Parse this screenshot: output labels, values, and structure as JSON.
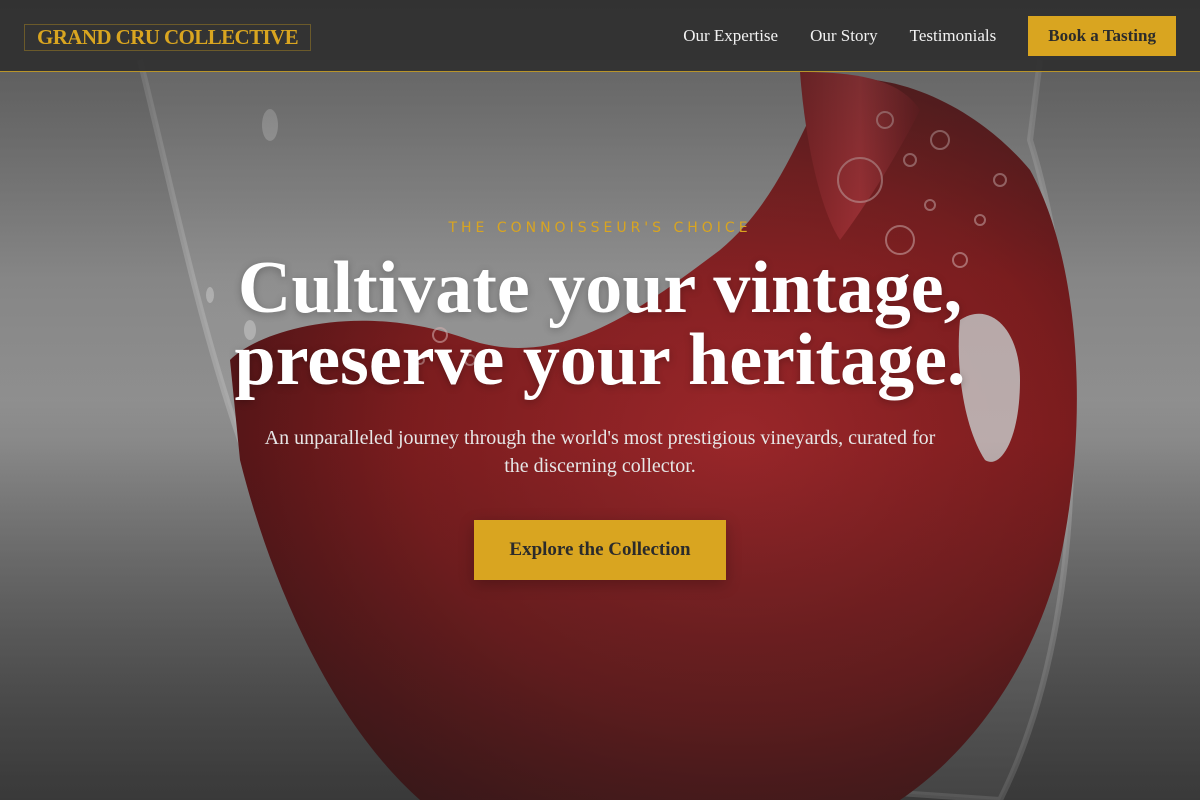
{
  "header": {
    "logo_text": "GRAND CRU COLLECTIVE",
    "nav": [
      {
        "label": "Our Expertise"
      },
      {
        "label": "Our Story"
      },
      {
        "label": "Testimonials"
      }
    ],
    "cta_label": "Book a Tasting"
  },
  "hero": {
    "background_image": "red-wine-pouring-into-glass",
    "eyebrow": "THE CONNOISSEUR'S CHOICE",
    "headline_line1": "Cultivate your vintage,",
    "headline_line2": "preserve your heritage.",
    "subtext": "An unparalleled journey through the world's most prestigious vineyards, curated for the discerning collector.",
    "button_label": "Explore the Collection"
  },
  "colors": {
    "accent": "#d9a520",
    "header_bg": "#303030",
    "header_border": "#b8942a",
    "wine": "#8e1a1c",
    "text_light": "#ffffff"
  }
}
